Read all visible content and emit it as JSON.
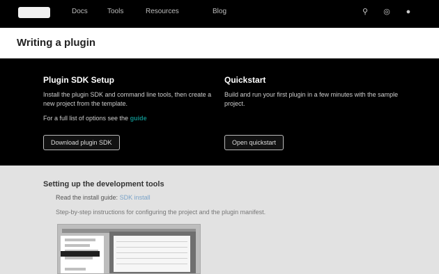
{
  "nav": {
    "links": [
      "Docs",
      "Tools",
      "Resources",
      "Blog"
    ],
    "icons": [
      "search-icon",
      "globe-icon",
      "user-icon"
    ]
  },
  "page": {
    "title": "Writing a plugin"
  },
  "hero": {
    "left": {
      "heading": "Plugin SDK Setup",
      "text": "Install the plugin SDK and command line tools, then create a new project from the template.",
      "note_prefix": "For a full list of options see the ",
      "note_link": "guide",
      "button": "Download plugin SDK"
    },
    "right": {
      "heading": "Quickstart",
      "text": "Build and run your first plugin in a few minutes with the sample project.",
      "button": "Open quickstart"
    }
  },
  "content": {
    "heading": "Setting up the development tools",
    "link_prefix": "Read the install guide: ",
    "link_text": "SDK install",
    "description": "Step-by-step instructions for configuring the project and the plugin manifest."
  },
  "colors": {
    "accent": "#0f8a86",
    "link": "#7aa3c8"
  }
}
